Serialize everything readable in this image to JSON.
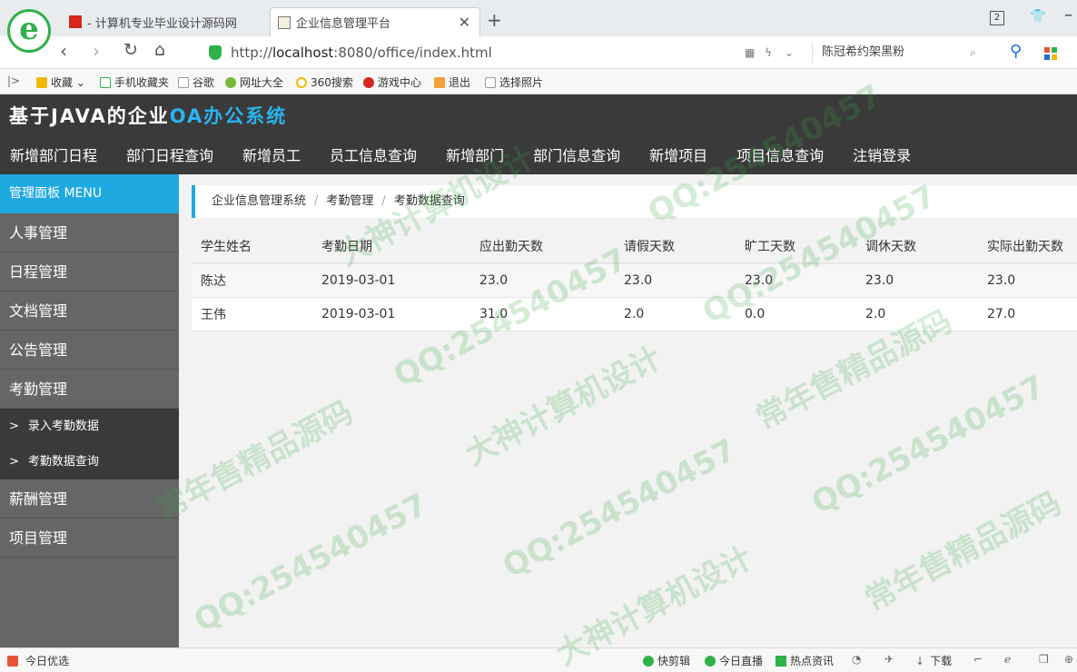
{
  "browser": {
    "tabs": [
      {
        "label": "- 计算机专业毕业设计源码网"
      },
      {
        "label": "企业信息管理平台"
      }
    ],
    "url_prefix": "http://",
    "url_host": "localhost",
    "url_rest": ":8080/office/index.html",
    "search_text": "陈冠希约架黑粉",
    "window_count": "2",
    "favorites": [
      "收藏",
      "手机收藏夹",
      "谷歌",
      "网址大全",
      "360搜索",
      "游戏中心",
      "退出",
      "选择照片"
    ],
    "status_left": "今日优选",
    "status_items": [
      "快剪辑",
      "今日直播",
      "热点资讯",
      "下载"
    ]
  },
  "app": {
    "title_main": "基于JAVA的企业",
    "title_accent": "OA办公系统",
    "topnav": [
      "新增部门日程",
      "部门日程查询",
      "新增员工",
      "员工信息查询",
      "新增部门",
      "部门信息查询",
      "新增项目",
      "项目信息查询",
      "注销登录"
    ]
  },
  "sidebar": {
    "header": "管理面板 MENU",
    "items": [
      "人事管理",
      "日程管理",
      "文档管理",
      "公告管理",
      "考勤管理"
    ],
    "subitems": [
      "录入考勤数据",
      "考勤数据查询"
    ],
    "items_after": [
      "薪酬管理",
      "项目管理"
    ]
  },
  "breadcrumb": [
    "企业信息管理系统",
    "考勤管理",
    "考勤数据查询"
  ],
  "table": {
    "headers": [
      "学生姓名",
      "考勤日期",
      "应出勤天数",
      "请假天数",
      "旷工天数",
      "调休天数",
      "实际出勤天数"
    ],
    "rows": [
      [
        "陈达",
        "2019-03-01",
        "23.0",
        "23.0",
        "23.0",
        "23.0",
        "23.0"
      ],
      [
        "王伟",
        "2019-03-01",
        "31.0",
        "2.0",
        "0.0",
        "2.0",
        "27.0"
      ]
    ]
  },
  "watermarks": [
    "常年售精品源码",
    "QQ:254540457",
    "大神计算机设计"
  ],
  "colors": {
    "header_bg": "#3a3a3a",
    "accent": "#1fa9e1",
    "sidebar_bg": "#666666",
    "submenu_bg": "#3a3a3a"
  }
}
